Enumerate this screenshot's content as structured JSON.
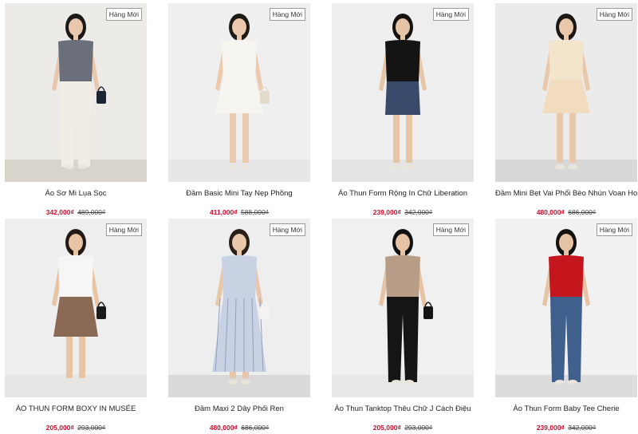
{
  "products": [
    {
      "name": "Áo Sơ Mi Lụa Sọc",
      "badge": "Hàng Mới",
      "sale_price": "342,000₫",
      "original_price": "489,000₫",
      "bg": "#ecebe7",
      "floor": "#d9d4cb",
      "top": "#6b6f7a",
      "bottom": "#f1ede4",
      "hair": "#1c1a18",
      "skin": "#e8c7ad",
      "bag": "#1d2433"
    },
    {
      "name": "Đầm Basic Mini Tay Nẹp Phồng",
      "badge": "Hàng Mới",
      "sale_price": "411,000₫",
      "original_price": "588,000₫",
      "bg": "#efefef",
      "floor": "#e6e6e6",
      "top": "#f7f5ef",
      "bottom": "#f7f5ef",
      "hair": "#1e1a16",
      "skin": "#ecc9ad",
      "bag": "#e4dccb"
    },
    {
      "name": "Áo Thun Form Rộng In Chữ Liberation",
      "badge": "Hàng Mới",
      "sale_price": "239,000₫",
      "original_price": "342,000₫",
      "bg": "#eeeeee",
      "floor": "#e4e4e4",
      "top": "#141414",
      "bottom": "#3a4a6b",
      "hair": "#161210",
      "skin": "#e6c4a6",
      "bag": "none"
    },
    {
      "name": "Đầm Mini Bẹt Vai Phối Bèo Nhún Voan Hoa",
      "badge": "Hàng Mới",
      "sale_price": "480,000₫",
      "original_price": "686,000₫",
      "bg": "#ebebeb",
      "floor": "#d8d8d8",
      "top": "#f3e4cc",
      "bottom": "#f1dcc0",
      "hair": "#1b1714",
      "skin": "#e9c7ab",
      "bag": "none"
    },
    {
      "name": "ÁO THUN FORM BOXY IN MUSÉE",
      "badge": "Hàng Mới",
      "sale_price": "205,000₫",
      "original_price": "293,000₫",
      "bg": "#eeeeee",
      "floor": "#e6e6e6",
      "top": "#f6f6f4",
      "bottom": "#8b6a55",
      "hair": "#231a14",
      "skin": "#e8c4a4",
      "bag": "#1a1a1a"
    },
    {
      "name": "Đầm Maxi 2 Dây Phối Ren",
      "badge": "Hàng Mới",
      "sale_price": "480,000₫",
      "original_price": "686,000₫",
      "bg": "#eeeeee",
      "floor": "#d9d9d9",
      "top": "#c9d2e3",
      "bottom": "#c9d2e3",
      "hair": "#2a1f18",
      "skin": "#e8c6aa",
      "bag": "#f3f3f3"
    },
    {
      "name": "Áo Thun Tanktop Thêu Chữ J Cách Điệu",
      "badge": "Hàng Mới",
      "sale_price": "205,000₫",
      "original_price": "293,000₫",
      "bg": "#f0f0f0",
      "floor": "#e8e8e8",
      "top": "#b89d86",
      "bottom": "#151515",
      "hair": "#111111",
      "skin": "#e6c3a4",
      "bag": "#151515"
    },
    {
      "name": "Áo Thun Form Baby Tee Cherie",
      "badge": "Hàng Mới",
      "sale_price": "239,000₫",
      "original_price": "342,000₫",
      "bg": "#f1f1f1",
      "floor": "#dcdcdc",
      "top": "#c4161c",
      "bottom": "#3f5f8c",
      "hair": "#141210",
      "skin": "#e6c3a4",
      "bag": "none"
    }
  ]
}
